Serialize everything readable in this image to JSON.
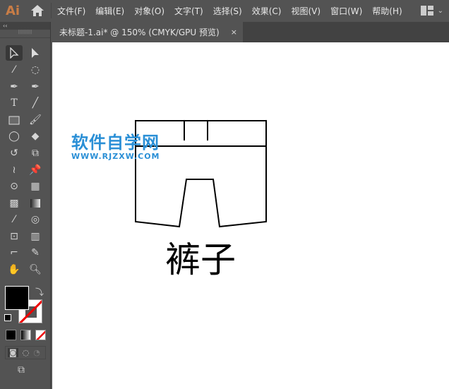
{
  "app": {
    "logo": "Ai"
  },
  "menu": [
    "文件(F)",
    "编辑(E)",
    "对象(O)",
    "文字(T)",
    "选择(S)",
    "效果(C)",
    "视图(V)",
    "窗口(W)",
    "帮助(H)"
  ],
  "tab": {
    "title": "未标题-1.ai* @ 150% (CMYK/GPU 预览)",
    "close": "×"
  },
  "toolbar": {
    "collapse": "‹‹"
  },
  "canvas": {
    "watermark_title": "软件自学网",
    "watermark_url": "WWW.RJZXW.COM",
    "label": "裤子"
  },
  "colors": {
    "fill": "#000000",
    "stroke": "none",
    "accent": "#c97d46"
  }
}
